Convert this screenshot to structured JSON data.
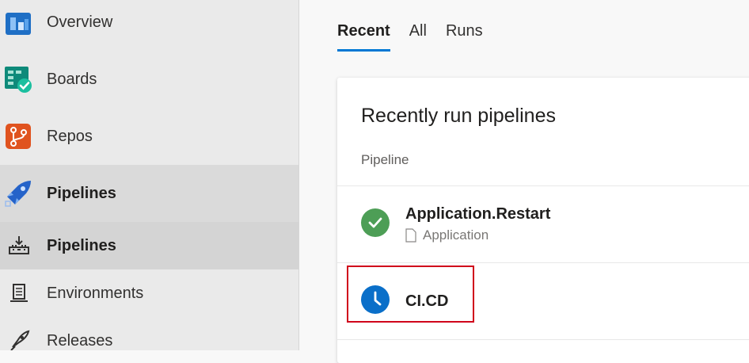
{
  "sidebar": {
    "items": [
      {
        "label": "Overview",
        "icon": "overview-icon"
      },
      {
        "label": "Boards",
        "icon": "boards-icon"
      },
      {
        "label": "Repos",
        "icon": "repos-icon"
      },
      {
        "label": "Pipelines",
        "icon": "pipelines-icon"
      }
    ],
    "sub_items": [
      {
        "label": "Pipelines",
        "icon": "pipelines-sub-icon"
      },
      {
        "label": "Environments",
        "icon": "environments-icon"
      },
      {
        "label": "Releases",
        "icon": "releases-icon"
      }
    ]
  },
  "tabs": [
    "Recent",
    "All",
    "Runs"
  ],
  "card": {
    "title": "Recently run pipelines",
    "column_header": "Pipeline",
    "rows": [
      {
        "name": "Application.Restart",
        "folder": "Application",
        "status": "succeeded"
      },
      {
        "name": "CI.CD",
        "status": "queued"
      }
    ]
  },
  "colors": {
    "accent": "#0078d4",
    "success": "#4d9e56",
    "queued": "#0a6fc9",
    "highlight": "#d0021b"
  }
}
